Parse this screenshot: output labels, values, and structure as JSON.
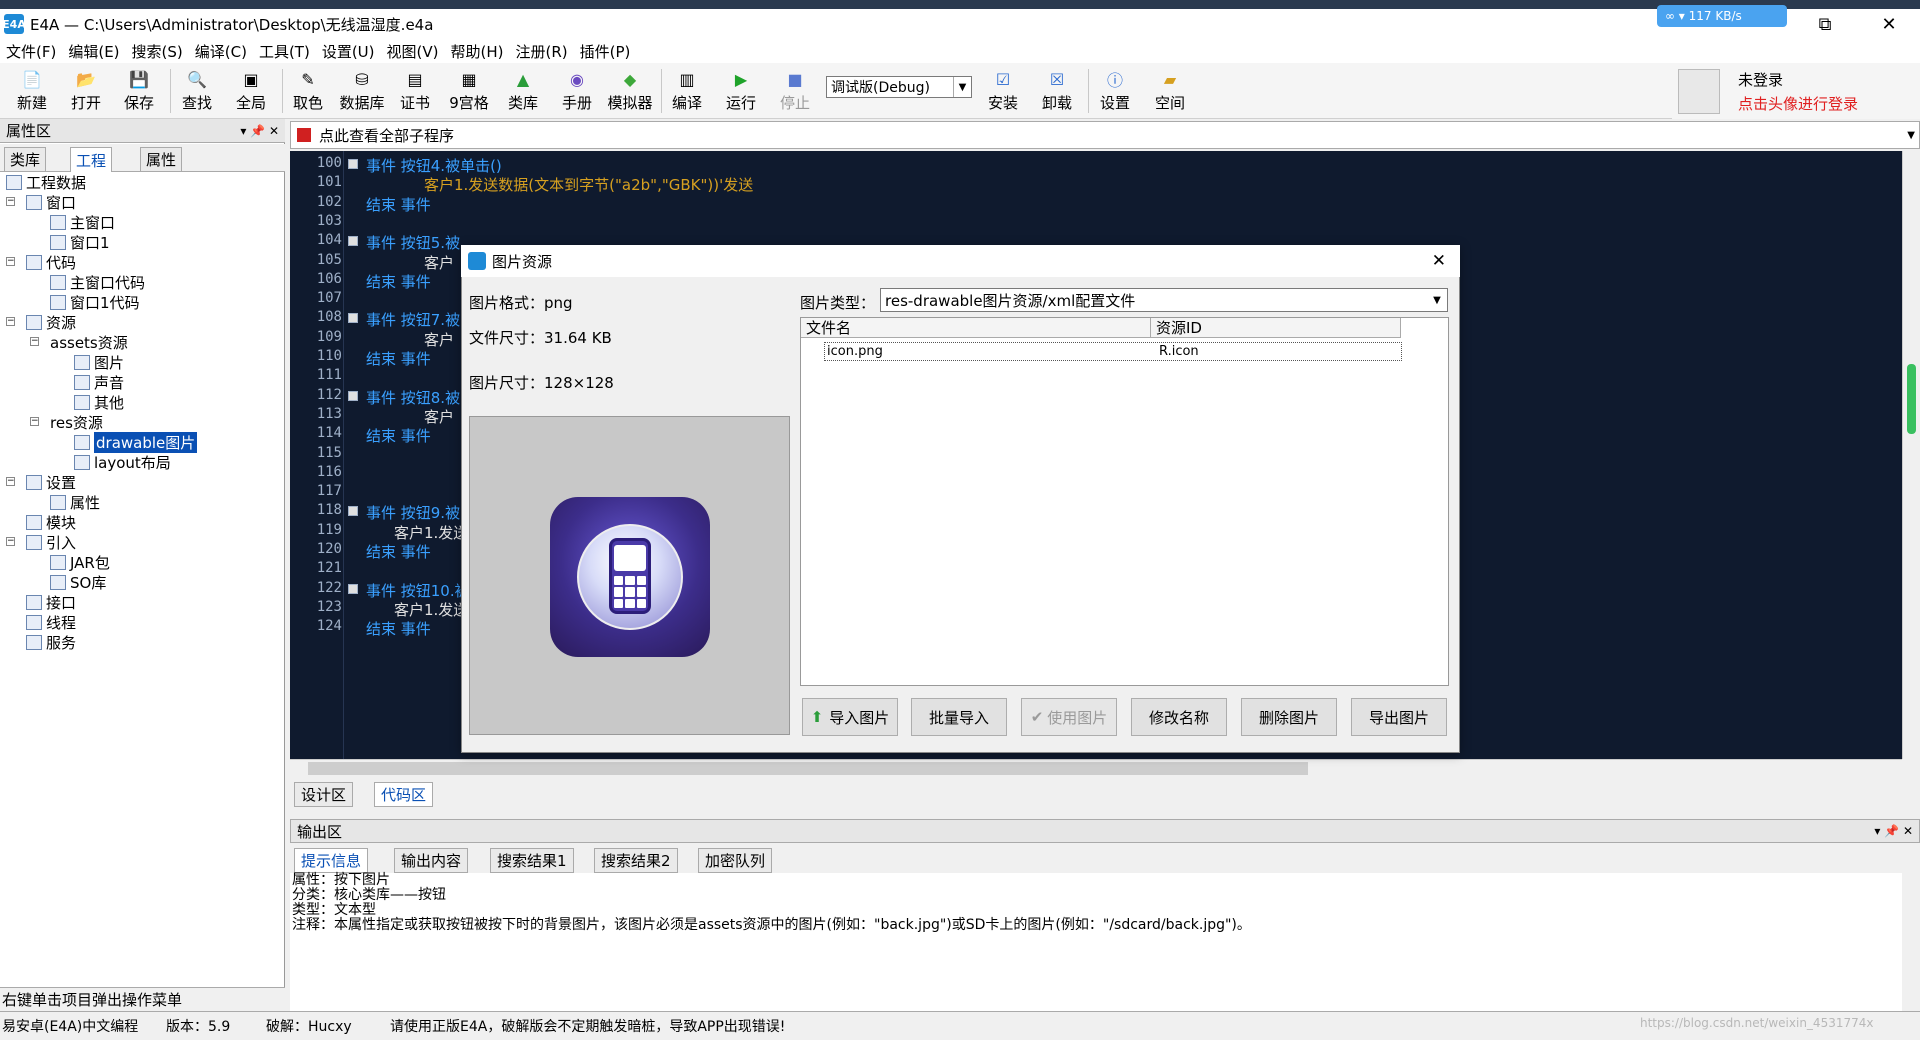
{
  "window": {
    "app_icon": "E4A",
    "title": "E4A — C:\\Users\\Administrator\\Desktop\\无线温湿度.e4a",
    "net_badge": "∞ ▾ 117 KB/s",
    "minimize": "—",
    "restore": "⧉",
    "close": "✕"
  },
  "menu": [
    "文件(F)",
    "编辑(E)",
    "搜索(S)",
    "编译(C)",
    "工具(T)",
    "设置(U)",
    "视图(V)",
    "帮助(H)",
    "注册(R)",
    "插件(P)"
  ],
  "toolbar": {
    "new": "新建",
    "open": "打开",
    "save": "保存",
    "find": "查找",
    "global": "全局",
    "pick_color": "取色",
    "database": "数据库",
    "cert": "证书",
    "grid9": "9宫格",
    "classlib": "类库",
    "manual": "手册",
    "emulator": "模拟器",
    "compile": "编译",
    "run": "运行",
    "stop": "停止",
    "build_mode": "调试版(Debug)",
    "install": "安装",
    "uninstall": "卸载",
    "settings": "设置",
    "space": "空间"
  },
  "user": {
    "status": "未登录",
    "hint": "点击头像进行登录"
  },
  "left_panel": {
    "title": "属性区",
    "header_controls": "▾ 📌 ✕",
    "tabs": [
      "类库",
      "工程",
      "属性"
    ],
    "active_tab": "工程",
    "tree": {
      "root": "工程数据",
      "window": "窗口",
      "main_window": "主窗口",
      "window1": "窗口1",
      "code": "代码",
      "main_window_code": "主窗口代码",
      "window1_code": "窗口1代码",
      "resources": "资源",
      "assets": "assets资源",
      "images": "图片",
      "sounds": "声音",
      "others": "其他",
      "res": "res资源",
      "drawable": "drawable图片",
      "layout": "layout布局",
      "settings": "设置",
      "properties": "属性",
      "modules": "模块",
      "imports": "引入",
      "jar": "JAR包",
      "so": "SO库",
      "interface": "接口",
      "thread": "线程",
      "service": "服务"
    },
    "status": "右键单击项目弹出操作菜单"
  },
  "code_header": "点此查看全部子程序",
  "code_lines": [
    {
      "n": "100",
      "t": "事件 按钮4.被单击()"
    },
    {
      "n": "101",
      "t": "客户1.发送数据(文本到字节(\"a2b\",\"GBK\"))'发送"
    },
    {
      "n": "102",
      "t": "结束 事件"
    },
    {
      "n": "103",
      "t": ""
    },
    {
      "n": "104",
      "t": "事件 按钮5.被"
    },
    {
      "n": "105",
      "t": "客户"
    },
    {
      "n": "106",
      "t": "结束 事件"
    },
    {
      "n": "107",
      "t": ""
    },
    {
      "n": "108",
      "t": "事件 按钮7.被"
    },
    {
      "n": "109",
      "t": "客户"
    },
    {
      "n": "110",
      "t": "结束 事件"
    },
    {
      "n": "111",
      "t": ""
    },
    {
      "n": "112",
      "t": "事件 按钮8.被"
    },
    {
      "n": "113",
      "t": "客户"
    },
    {
      "n": "114",
      "t": "结束 事件"
    },
    {
      "n": "115",
      "t": ""
    },
    {
      "n": "116",
      "t": ""
    },
    {
      "n": "117",
      "t": ""
    },
    {
      "n": "118",
      "t": "事件 按钮9.被"
    },
    {
      "n": "119",
      "t": "客户1.发送"
    },
    {
      "n": "120",
      "t": "结束 事件"
    },
    {
      "n": "121",
      "t": ""
    },
    {
      "n": "122",
      "t": "事件 按钮10.被"
    },
    {
      "n": "123",
      "t": "客户1.发送"
    },
    {
      "n": "124",
      "t": "结束 事件"
    }
  ],
  "code_tabs": [
    "设计区",
    "代码区"
  ],
  "output": {
    "title": "输出区",
    "header_controls": "▾ 📌 ✕",
    "tabs": [
      "提示信息",
      "输出内容",
      "搜索结果1",
      "搜索结果2",
      "加密队列"
    ],
    "lines": [
      "属性：按下图片",
      "分类：核心类库——按钮",
      "类型：文本型",
      "注释：本属性指定或获取按钮被按下时的背景图片，该图片必须是assets资源中的图片(例如：\"back.jpg\")或SD卡上的图片(例如：\"/sdcard/back.jpg\")。"
    ]
  },
  "status_bar": {
    "product": "易安卓(E4A)中文编程",
    "version": "版本：5.9",
    "crack": "破解：Hucxy",
    "warning": "请使用正版E4A，破解版会不定期触发暗桩，导致APP出现错误!",
    "watermark": "https://blog.csdn.net/weixin_4531774x"
  },
  "dialog": {
    "title": "图片资源",
    "close": "✕",
    "format": "图片格式：png",
    "file_size": "文件尺寸：31.64 KB",
    "image_size": "图片尺寸：128×128",
    "type_label": "图片类型：",
    "type_value": "res-drawable图片资源/xml配置文件",
    "columns": [
      "文件名",
      "资源ID"
    ],
    "rows": [
      {
        "file": "icon.png",
        "id": "R.icon"
      }
    ],
    "buttons": {
      "import": "导入图片",
      "batch_import": "批量导入",
      "use": "使用图片",
      "rename": "修改名称",
      "delete": "删除图片",
      "export": "导出图片"
    }
  },
  "colors": {
    "code_bg": "#0f1a2e",
    "keyword": "#3aa0ff",
    "function": "#d6a020",
    "comment": "#60c840",
    "link_red": "#e02020",
    "selection": "#0a50b4"
  }
}
